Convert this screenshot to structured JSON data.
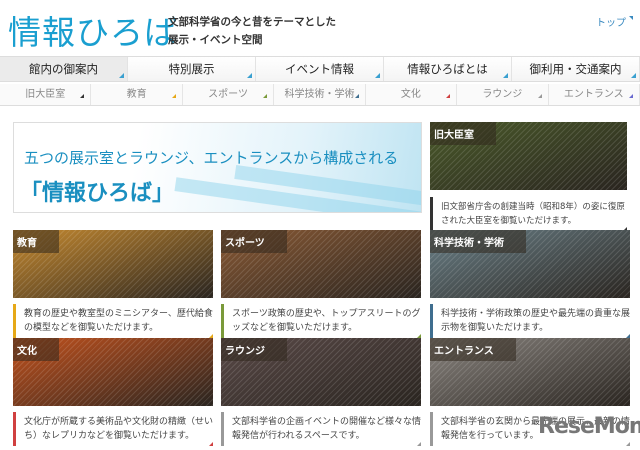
{
  "header": {
    "logo": "情報ひろば",
    "tagline1": "文部科学省の今と昔をテーマとした",
    "tagline2": "展示・イベント空間",
    "top_link": "トップ"
  },
  "nav": [
    "館内の御案内",
    "特別展示",
    "イベント情報",
    "情報ひろばとは",
    "御利用・交通案内"
  ],
  "subnav": [
    {
      "label": "旧大臣室",
      "color": "#333333"
    },
    {
      "label": "教育",
      "color": "#e6a817"
    },
    {
      "label": "スポーツ",
      "color": "#7a9a3a"
    },
    {
      "label": "科学技術・学術",
      "color": "#3f6e8f"
    },
    {
      "label": "文化",
      "color": "#d04040"
    },
    {
      "label": "ラウンジ",
      "color": "#999999"
    },
    {
      "label": "エントランス",
      "color": "#6a6ad0"
    }
  ],
  "hero": {
    "line1": "五つの展示室とラウンジ、エントランスから構成される",
    "line2": "「情報ひろば」"
  },
  "cards": [
    {
      "label": "旧大臣室",
      "desc": "旧文部省庁舎の創建当時（昭和8年）の姿に復原された大臣室を御覧いただけます。",
      "accent": "#333333",
      "bg": "#4a5a2a"
    },
    {
      "label": "教育",
      "desc": "教育の歴史や教室型のミニシアター、歴代給食の模型などを御覧いただけます。",
      "accent": "#e6a817",
      "bg": "#c68a30"
    },
    {
      "label": "スポーツ",
      "desc": "スポーツ政策の歴史や、トップアスリートのグッズなどを御覧いただけます。",
      "accent": "#7a9a3a",
      "bg": "#8a5a35"
    },
    {
      "label": "科学技術・学術",
      "desc": "科学技術・学術政策の歴史や最先端の貴重な展示物を御覧いただけます。",
      "accent": "#3f6e8f",
      "bg": "#6a8088"
    },
    {
      "label": "文化",
      "desc": "文化庁が所蔵する美術品や文化財の精緻（せいち）なレプリカなどを御覧いただけます。",
      "accent": "#d04040",
      "bg": "#c2521e"
    },
    {
      "label": "ラウンジ",
      "desc": "文部科学省の企画イベントの開催など様々な情報発信が行われるスペースです。",
      "accent": "#999999",
      "bg": "#5a4a48"
    },
    {
      "label": "エントランス",
      "desc": "文部科学省の玄関から最先端の展示、最新の情報発信を行っています。",
      "accent": "#999999",
      "bg": "#8a8580"
    }
  ],
  "watermark": "ReseMom"
}
